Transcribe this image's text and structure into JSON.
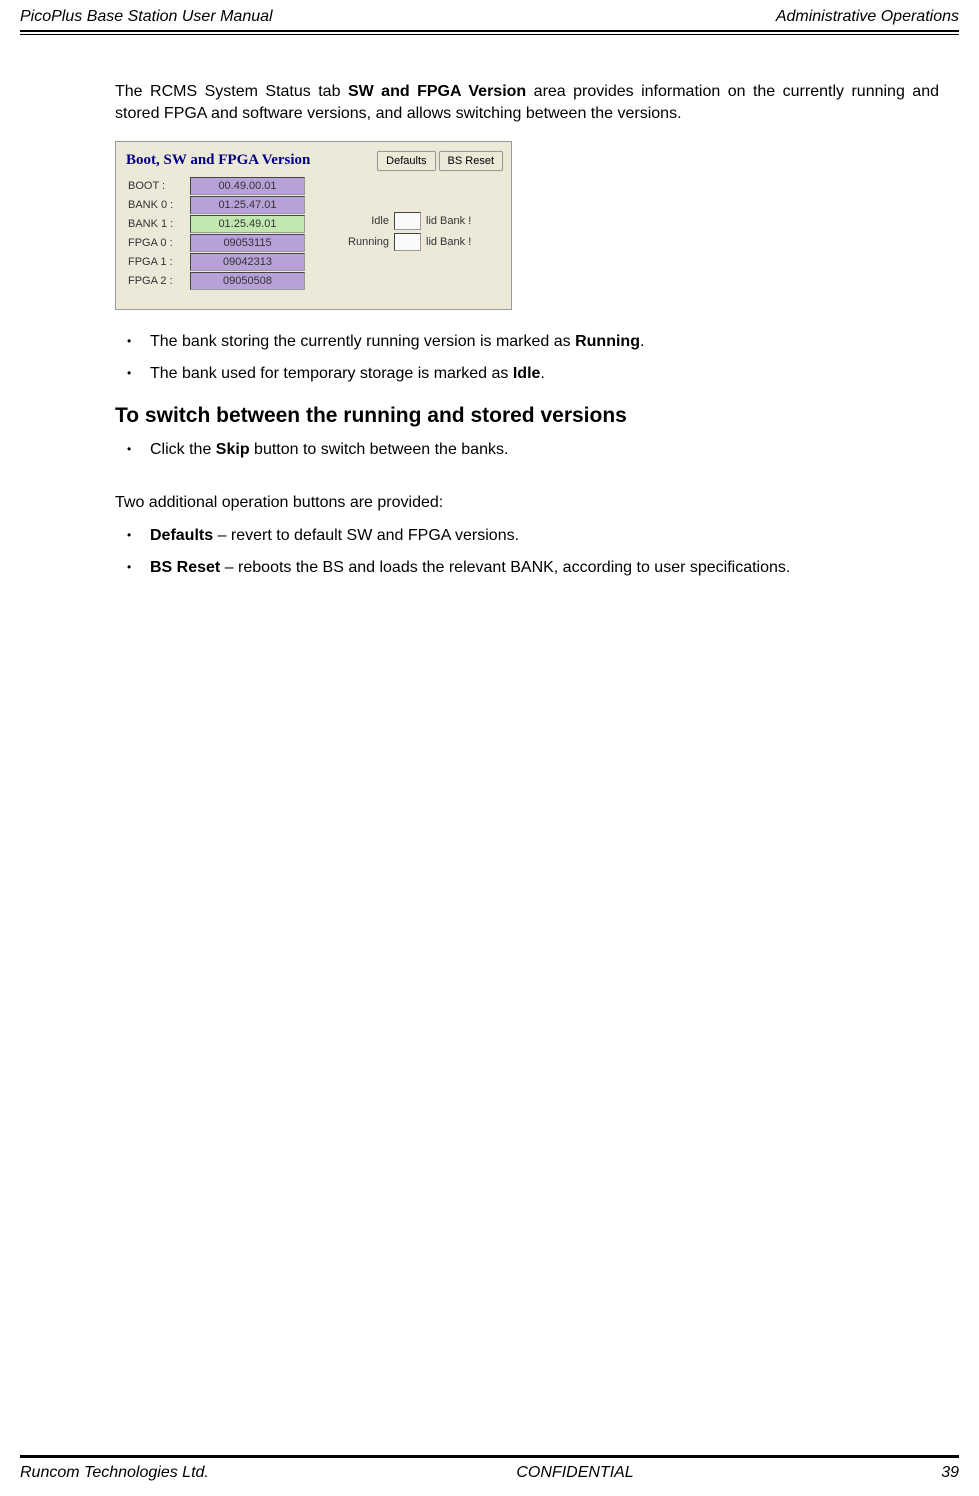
{
  "header": {
    "left": "PicoPlus Base Station User Manual",
    "right": "Administrative Operations"
  },
  "intro": {
    "pre": "The RCMS System Status tab ",
    "bold": "SW and FPGA Version",
    "post": " area provides information on the currently running and stored FPGA and software versions, and allows switching between the versions."
  },
  "panel": {
    "title": "Boot, SW and FPGA Version",
    "rows": [
      {
        "label": "BOOT :",
        "value": "00.49.00.01",
        "class": "bg-purple"
      },
      {
        "label": "BANK 0 :",
        "value": "01.25.47.01",
        "class": "bg-purple"
      },
      {
        "label": "BANK 1 :",
        "value": "01.25.49.01",
        "class": "bg-green"
      },
      {
        "label": "FPGA 0 :",
        "value": "09053115",
        "class": "bg-purple"
      },
      {
        "label": "FPGA 1 :",
        "value": "09042313",
        "class": "bg-purple"
      },
      {
        "label": "FPGA 2 :",
        "value": "09050508",
        "class": "bg-purple"
      }
    ],
    "buttons": {
      "defaults": "Defaults",
      "bsreset": "BS Reset"
    },
    "status": [
      {
        "label": "Idle",
        "text": "lid Bank !"
      },
      {
        "label": "Running",
        "text": "lid Bank !"
      }
    ]
  },
  "bullets1": [
    {
      "pre": "The bank storing the currently running version is marked as ",
      "bold": "Running",
      "post": "."
    },
    {
      "pre": "The bank used for temporary storage is marked as ",
      "bold": "Idle",
      "post": "."
    }
  ],
  "heading": "To switch between the running and stored versions",
  "bullets2": [
    {
      "pre": "Click the ",
      "bold": "Skip",
      "post": " button to switch between the banks."
    }
  ],
  "para2": "Two additional operation buttons are provided:",
  "bullets3": [
    {
      "bold": "Defaults",
      "post": " – revert to default SW and FPGA versions."
    },
    {
      "bold": "BS Reset",
      "post": " – reboots the BS and loads the relevant BANK, according to user specifications."
    }
  ],
  "footer": {
    "left": "Runcom Technologies Ltd.",
    "center": "CONFIDENTIAL",
    "right": "39"
  }
}
